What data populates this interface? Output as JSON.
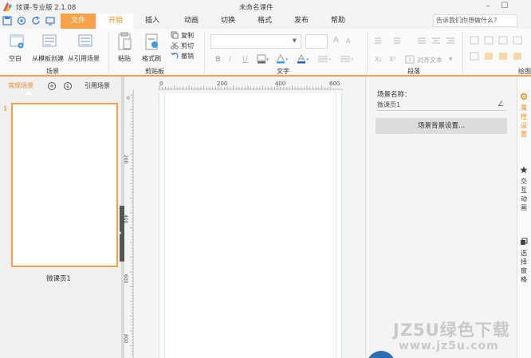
{
  "window": {
    "app_title": "炫课-专业版 2.1.08",
    "doc_title": "未命名课件",
    "minimize": "–",
    "maximize": "☐"
  },
  "menu": {
    "items": [
      "文件",
      "开始",
      "插入",
      "动画",
      "切换",
      "格式",
      "发布",
      "帮助"
    ],
    "search_placeholder": "告诉我们你想做什么？"
  },
  "ribbon": {
    "scene_group": {
      "buttons": [
        "空白",
        "从模板创建",
        "从引用场景"
      ],
      "label": "场景"
    },
    "clipboard_group": {
      "buttons": [
        "粘贴",
        "格式刷"
      ],
      "small": [
        "复制",
        "剪切",
        "撤销"
      ],
      "label": "剪贴板"
    },
    "text_group": {
      "font_size_up": "A",
      "font_size_down": "A",
      "bold": "B",
      "italic": "I",
      "underline": "U",
      "label": "文字"
    },
    "paragraph_group": {
      "align_text": "对齐文本",
      "label": "段落"
    },
    "drawing_group": {
      "label": "绘图"
    }
  },
  "left_panel": {
    "tabs": [
      "常规场景",
      "引用场景"
    ],
    "add_symbol": "+",
    "down_symbol": "↓",
    "slides": [
      {
        "number": "1",
        "name": "微课页1"
      }
    ]
  },
  "ruler": {
    "h_labels": [
      "0",
      "200",
      "400",
      "600"
    ],
    "v_labels": [
      "0",
      "200",
      "400",
      "600",
      "800"
    ]
  },
  "properties": {
    "name_label": "场景名称：",
    "name_value": "微课页1",
    "edit_icon_glyph": "∠",
    "bg_settings_button": "场景背景设置..."
  },
  "right_tabs": [
    "属性设置",
    "交互动画",
    "选择窗格"
  ],
  "watermark": {
    "main": "JZ5U绿色下载",
    "url": "www.jz5u.com"
  },
  "colors": {
    "accent": "#f5a04b",
    "accent_text": "#f08a24",
    "watermark_blue": "#2d6fb5"
  }
}
